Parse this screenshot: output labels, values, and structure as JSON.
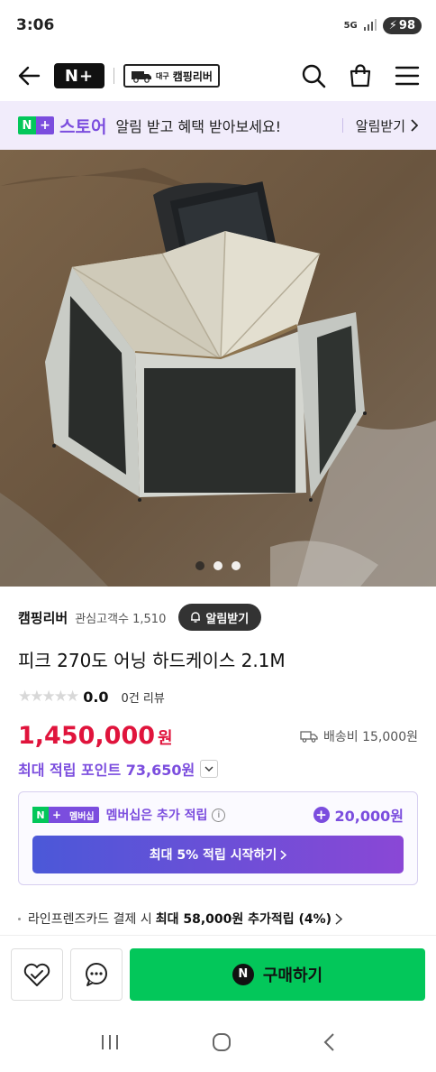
{
  "status_bar": {
    "time": "3:06",
    "network": "5G",
    "battery": "98"
  },
  "header": {
    "back_icon": "arrow-left-icon",
    "brand_logo": "N+",
    "store_logo": "캠핑리버",
    "store_logo_sub": "대구",
    "icons": [
      "search-icon",
      "shopping-bag-icon",
      "menu-icon"
    ]
  },
  "promo_banner": {
    "store_label": "스토어",
    "message": "알림 받고 혜택 받아보세요!",
    "cta": "알림받기"
  },
  "hero": {
    "image_desc": "tent-photo",
    "dots_total": 3,
    "dots_active": 1
  },
  "store": {
    "name": "캠핑리버",
    "follower_label": "관심고객수 1,510",
    "alarm_button": "알림받기"
  },
  "product": {
    "title": "피크 270도 어닝 하드케이스 2.1M",
    "rating": "0.0",
    "review_count": "0건 리뷰",
    "price": "1,450,000",
    "currency": "원",
    "shipping": "배송비 15,000원",
    "points": "최대 적립 포인트 73,650원"
  },
  "membership": {
    "badge": "멤버십",
    "description": "멤버십은 추가 적립",
    "amount": "20,000원",
    "cta": "최대 5% 적립 시작하기"
  },
  "card_promo": {
    "prefix": "라인프렌즈카드 결제 시",
    "highlight": "최대 58,000원 추가적립 (4%)"
  },
  "bottom_actions": {
    "buy_label": "구매하기",
    "buy_icon": "N"
  },
  "colors": {
    "naver_green": "#03c75a",
    "purple": "#7b4dde",
    "price_red": "#e0143c"
  }
}
